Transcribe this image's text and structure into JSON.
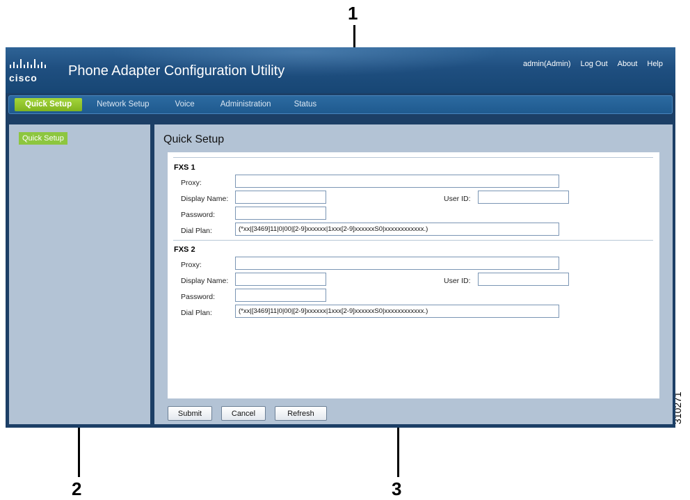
{
  "callouts": [
    "1",
    "2",
    "3"
  ],
  "figure_id": "310271",
  "header": {
    "logo_text": "cisco",
    "title": "Phone Adapter Configuration Utility",
    "user": "admin(Admin)",
    "logout": "Log Out",
    "about": "About",
    "help": "Help"
  },
  "nav": {
    "tabs": [
      {
        "label": "Quick Setup",
        "active": true
      },
      {
        "label": "Network Setup"
      },
      {
        "label": "Voice"
      },
      {
        "label": "Administration"
      },
      {
        "label": "Status"
      }
    ]
  },
  "sidebar": {
    "items": [
      {
        "label": "Quick Setup",
        "active": true
      }
    ]
  },
  "main": {
    "title": "Quick Setup",
    "sections": [
      {
        "title": "FXS 1",
        "proxy_label": "Proxy:",
        "display_name_label": "Display Name:",
        "user_id_label": "User ID:",
        "password_label": "Password:",
        "dial_plan_label": "Dial Plan:",
        "proxy": "",
        "display_name": "",
        "user_id": "",
        "password": "",
        "dial_plan": "(*xx|[3469]11|0|00|[2-9]xxxxxx|1xxx[2-9]xxxxxxS0|xxxxxxxxxxxx.)"
      },
      {
        "title": "FXS 2",
        "proxy_label": "Proxy:",
        "display_name_label": "Display Name:",
        "user_id_label": "User ID:",
        "password_label": "Password:",
        "dial_plan_label": "Dial Plan:",
        "proxy": "",
        "display_name": "",
        "user_id": "",
        "password": "",
        "dial_plan": "(*xx|[3469]11|0|00|[2-9]xxxxxx|1xxx[2-9]xxxxxxS0|xxxxxxxxxxxx.)"
      }
    ],
    "buttons": {
      "submit": "Submit",
      "cancel": "Cancel",
      "refresh": "Refresh"
    }
  },
  "colors": {
    "header": "#1f4f80",
    "accent_green": "#8dc63f",
    "panel_bg": "#b3c3d5"
  }
}
